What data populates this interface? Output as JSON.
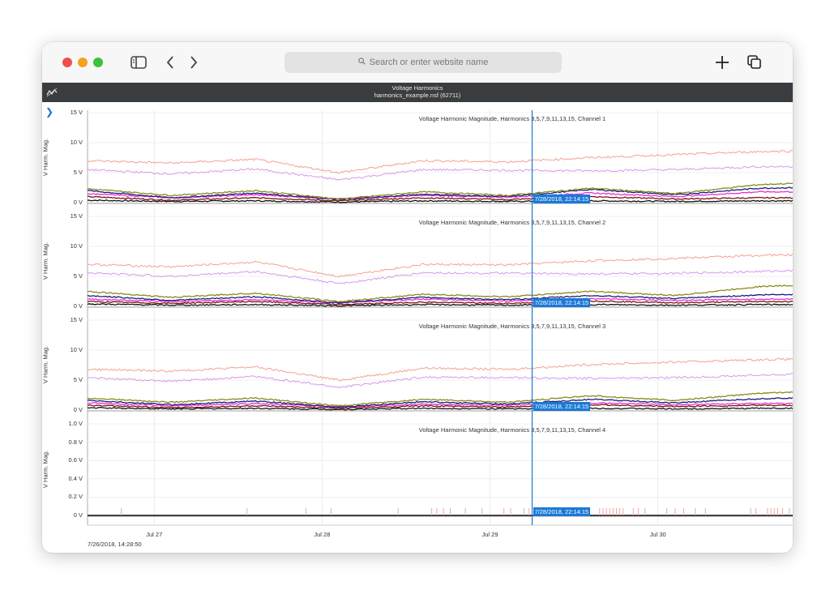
{
  "browser": {
    "search_placeholder": "Search or enter website name",
    "icons": [
      "sidebar-icon",
      "back-icon",
      "forward-icon",
      "new-tab-icon",
      "tabs-overview-icon",
      "search-icon"
    ]
  },
  "app": {
    "title": "Voltage Harmonics",
    "subtitle": "harmonics_example.nsf (62711)",
    "icon": "waveform-icon",
    "expand_icon": "chevron-right-icon"
  },
  "cursor": {
    "label": "7/28/2018, 22:14:15",
    "x_day": 2.648
  },
  "time_axis": {
    "start_label": "7/26/2018, 14:28:50",
    "ticks": [
      {
        "label": "Jul 27",
        "day": 0.397
      },
      {
        "label": "Jul 28",
        "day": 1.397
      },
      {
        "label": "Jul 29",
        "day": 2.397
      },
      {
        "label": "Jul 30",
        "day": 3.397
      }
    ],
    "range_days": [
      0,
      4.2
    ]
  },
  "colors": {
    "h3": "#f4a093",
    "h5": "#d798ee",
    "h7": "#8a8a1a",
    "h9": "#1c1c7a",
    "h11": "#e42fd9",
    "h13": "#7a1414",
    "h15": "#111111",
    "cursor": "#1b79d6",
    "spike": "#f39c9c"
  },
  "chart_data": [
    {
      "type": "line",
      "title": "Voltage Harmonic Magnitude, Harmonics 3,5,7,9,11,13,15, Channel 1",
      "ylabel": "V Harm. Mag.",
      "yticks": [
        "15 V",
        "10 V",
        "5 V",
        "0 V"
      ],
      "ylim": [
        0,
        15
      ],
      "x": [
        0,
        0.5,
        1.0,
        1.5,
        2.0,
        2.5,
        3.0,
        3.5,
        4.0,
        4.2
      ],
      "series": [
        {
          "name": "H3",
          "values": [
            7.0,
            6.6,
            7.2,
            5.0,
            7.0,
            6.8,
            7.5,
            8.0,
            8.5,
            8.6
          ]
        },
        {
          "name": "H5",
          "values": [
            5.5,
            4.8,
            5.6,
            3.8,
            5.5,
            5.4,
            5.3,
            5.5,
            6.0,
            6.0
          ]
        },
        {
          "name": "H7",
          "values": [
            2.3,
            1.2,
            2.0,
            0.6,
            1.8,
            1.2,
            2.4,
            1.5,
            3.0,
            3.2
          ]
        },
        {
          "name": "H9",
          "values": [
            2.0,
            0.8,
            1.6,
            0.5,
            1.4,
            1.0,
            2.2,
            1.3,
            2.4,
            2.5
          ]
        },
        {
          "name": "H11",
          "values": [
            1.5,
            0.8,
            1.3,
            0.6,
            1.2,
            0.9,
            1.6,
            1.0,
            1.8,
            1.8
          ]
        },
        {
          "name": "H13",
          "values": [
            1.0,
            0.4,
            0.8,
            0.3,
            0.8,
            0.5,
            1.0,
            0.6,
            0.8,
            0.8
          ]
        },
        {
          "name": "H15",
          "values": [
            0.4,
            0.2,
            0.3,
            0.1,
            0.3,
            0.2,
            0.3,
            0.2,
            0.3,
            0.3
          ]
        }
      ]
    },
    {
      "type": "line",
      "title": "Voltage Harmonic Magnitude, Harmonics 3,5,7,9,11,13,15, Channel 2",
      "ylabel": "V Harm. Mag.",
      "yticks": [
        "15 V",
        "10 V",
        "5 V",
        "0 V"
      ],
      "ylim": [
        0,
        15
      ],
      "x": [
        0,
        0.5,
        1.0,
        1.5,
        2.0,
        2.5,
        3.0,
        3.5,
        4.0,
        4.2
      ],
      "series": [
        {
          "name": "H3",
          "values": [
            7.0,
            6.6,
            7.4,
            5.0,
            7.0,
            6.9,
            7.6,
            8.0,
            8.5,
            8.6
          ]
        },
        {
          "name": "H5",
          "values": [
            5.6,
            5.0,
            5.8,
            3.8,
            5.6,
            5.5,
            5.4,
            5.5,
            5.8,
            6.0
          ]
        },
        {
          "name": "H7",
          "values": [
            2.5,
            1.5,
            2.2,
            0.8,
            2.0,
            1.6,
            2.5,
            1.8,
            3.3,
            3.5
          ]
        },
        {
          "name": "H9",
          "values": [
            1.8,
            1.0,
            1.6,
            0.6,
            1.5,
            1.1,
            1.8,
            1.3,
            1.9,
            2.0
          ]
        },
        {
          "name": "H11",
          "values": [
            1.2,
            0.8,
            1.1,
            0.6,
            1.2,
            0.9,
            1.3,
            1.0,
            1.2,
            1.2
          ]
        },
        {
          "name": "H13",
          "values": [
            0.8,
            0.5,
            0.8,
            0.3,
            0.7,
            0.5,
            0.9,
            0.6,
            0.8,
            0.8
          ]
        },
        {
          "name": "H15",
          "values": [
            0.4,
            0.2,
            0.3,
            0.1,
            0.3,
            0.2,
            0.3,
            0.2,
            0.3,
            0.3
          ]
        }
      ]
    },
    {
      "type": "line",
      "title": "Voltage Harmonic Magnitude, Harmonics 3,5,7,9,11,13,15, Channel 3",
      "ylabel": "V Harm. Mag.",
      "yticks": [
        "15 V",
        "10 V",
        "5 V",
        "0 V"
      ],
      "ylim": [
        0,
        15
      ],
      "x": [
        0,
        0.5,
        1.0,
        1.5,
        2.0,
        2.5,
        3.0,
        3.5,
        4.0,
        4.2
      ],
      "series": [
        {
          "name": "H3",
          "values": [
            6.8,
            6.5,
            7.2,
            5.0,
            7.0,
            6.8,
            7.6,
            8.0,
            8.4,
            8.5
          ]
        },
        {
          "name": "H5",
          "values": [
            5.4,
            4.8,
            5.6,
            3.8,
            5.5,
            5.4,
            5.3,
            5.4,
            5.8,
            6.0
          ]
        },
        {
          "name": "H7",
          "values": [
            2.0,
            1.3,
            2.0,
            0.7,
            1.8,
            1.3,
            2.4,
            1.6,
            2.8,
            3.0
          ]
        },
        {
          "name": "H9",
          "values": [
            1.6,
            0.9,
            1.5,
            0.5,
            1.4,
            1.0,
            1.8,
            1.2,
            1.9,
            2.0
          ]
        },
        {
          "name": "H11",
          "values": [
            1.2,
            0.7,
            1.1,
            0.5,
            1.0,
            0.8,
            1.2,
            0.9,
            1.1,
            1.1
          ]
        },
        {
          "name": "H13",
          "values": [
            0.8,
            0.4,
            0.7,
            0.3,
            0.7,
            0.5,
            0.9,
            0.6,
            0.8,
            0.8
          ]
        },
        {
          "name": "H15",
          "values": [
            0.4,
            0.2,
            0.3,
            0.1,
            0.3,
            0.2,
            0.3,
            0.2,
            0.3,
            0.3
          ]
        }
      ]
    },
    {
      "type": "line",
      "title": "Voltage Harmonic Magnitude, Harmonics 3,5,7,9,11,13,15, Channel 4",
      "ylabel": "V Harm. Mag.",
      "yticks": [
        "1.0 V",
        "0.8 V",
        "0.6 V",
        "0.4 V",
        "0.2 V",
        "0 V"
      ],
      "ylim": [
        0,
        1.0
      ],
      "baseline_value": 0,
      "spike_days": [
        0.2,
        0.95,
        1.3,
        1.45,
        1.85,
        2.05,
        2.08,
        2.12,
        2.16,
        2.25,
        2.35,
        2.48,
        2.52,
        2.6,
        2.63,
        3.05,
        3.07,
        3.09,
        3.11,
        3.13,
        3.15,
        3.17,
        3.19,
        3.25,
        3.28,
        3.32,
        3.45,
        3.5,
        3.55,
        3.62,
        3.68,
        3.95,
        3.98,
        4.05,
        4.07,
        4.09,
        4.11,
        4.14,
        4.18
      ],
      "spike_value": 0.08
    }
  ]
}
